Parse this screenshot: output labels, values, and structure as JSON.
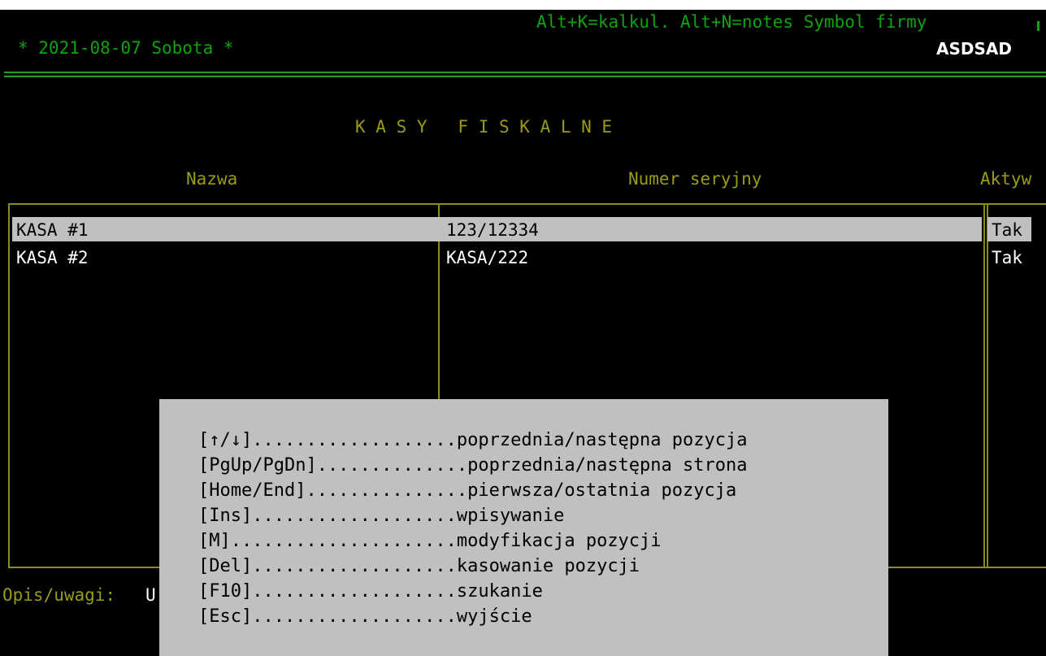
{
  "header": {
    "date_line": "* 2021-08-07 Sobota *",
    "hotkeys": "Alt+K=kalkul. Alt+N=notes Symbol firmy",
    "company_symbol": "ASDSAD"
  },
  "title": "K A S Y   F I S K A L N E",
  "columns": {
    "name": "Nazwa",
    "serial": "Numer seryjny",
    "active": "Aktyw"
  },
  "rows": [
    {
      "name": "KASA #1",
      "serial": "123/12334",
      "active": "Tak"
    },
    {
      "name": "KASA #2",
      "serial": "KASA/222",
      "active": "Tak"
    }
  ],
  "footer": {
    "opis_label": "Opis/uwagi:",
    "opis_value": "U"
  },
  "help": [
    "[↑/↓]...................poprzednia/następna pozycja",
    "[PgUp/PgDn]..............poprzednia/następna strona",
    "[Home/End]...............pierwsza/ostatnia pozycja",
    "[Ins]...................wpisywanie",
    "[M].....................modyfikacja pozycji",
    "[Del]...................kasowanie pozycji",
    "[F10]...................szukanie",
    "[Esc]...................wyjście"
  ],
  "colors": {
    "background": "#000000",
    "header_green": "#12a112",
    "title_olive": "#9a9a1a",
    "selection": "#c0c0c0"
  }
}
